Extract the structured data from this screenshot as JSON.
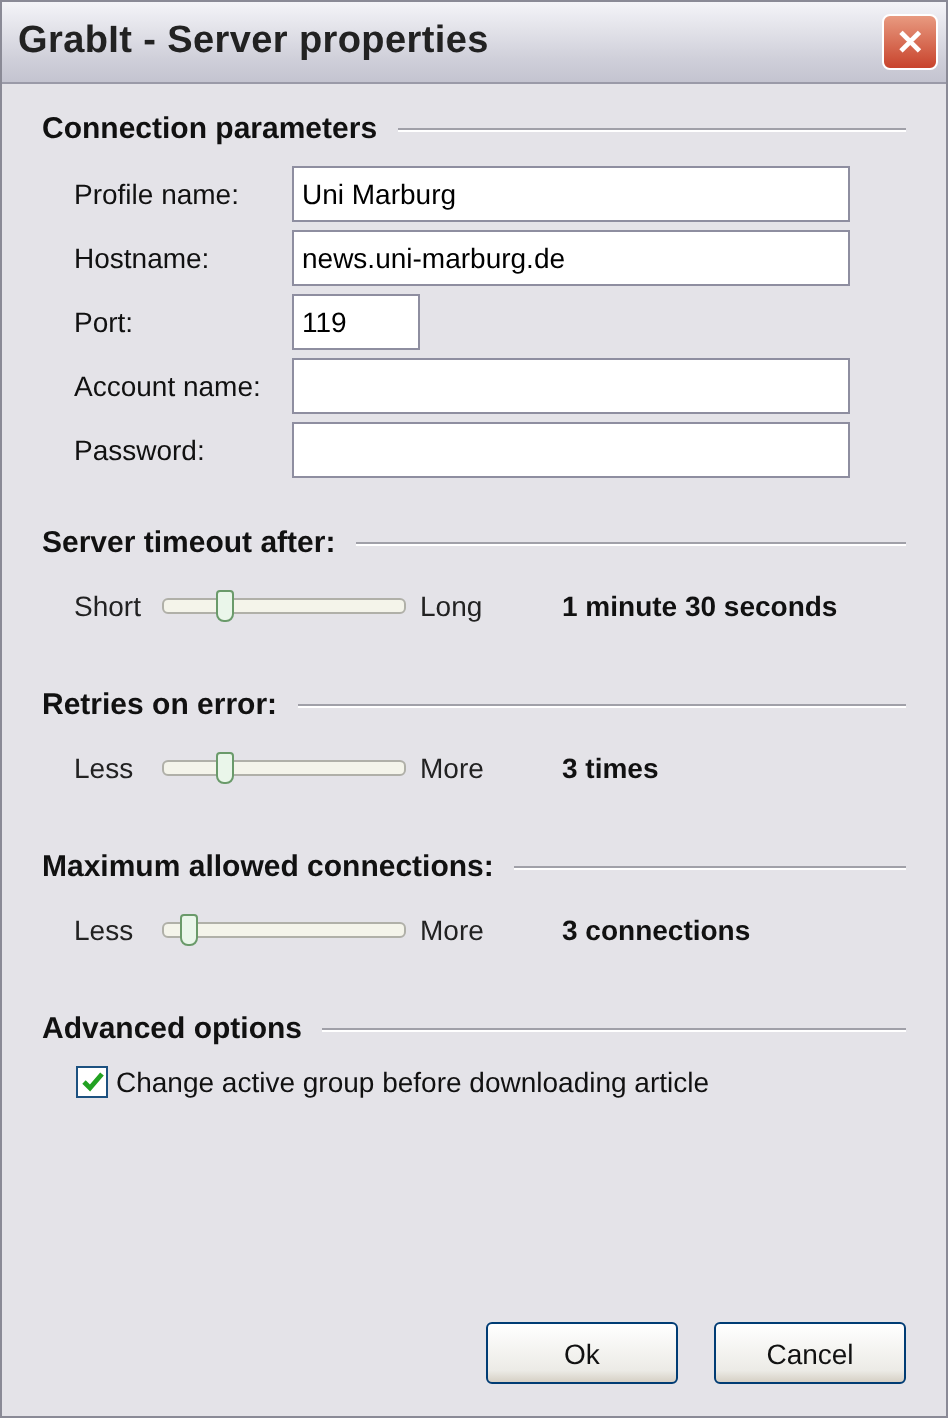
{
  "window": {
    "title": "GrabIt - Server properties",
    "close_label": "✕"
  },
  "sections": [
    {
      "kind": "fields",
      "title": "Connection parameters",
      "fields": [
        {
          "label": "Profile name:",
          "value": "Uni Marburg",
          "kind": "wide"
        },
        {
          "label": "Hostname:",
          "value": "news.uni-marburg.de",
          "kind": "wide"
        },
        {
          "label": "Port:",
          "value": "119",
          "kind": "narrow"
        },
        {
          "label": "Account name:",
          "kind": "wide"
        },
        {
          "label": "Password:",
          "kind": "wide"
        }
      ]
    },
    {
      "kind": "slider",
      "title": "Server timeout after:",
      "min_label": "Short",
      "max_label": "Long",
      "level": 0.25,
      "reading": "1 minute 30 seconds"
    },
    {
      "kind": "slider",
      "title": "Retries on error:",
      "min_label": "Less",
      "max_label": "More",
      "level": 0.25,
      "reading": "3 times"
    },
    {
      "kind": "slider",
      "title": "Maximum allowed connections:",
      "min_label": "Less",
      "max_label": "More",
      "level": 0.1,
      "reading": "3 connections"
    },
    {
      "kind": "checks",
      "title": "Advanced options",
      "options": [
        {
          "label": "Change active group before downloading article",
          "checked": true
        }
      ]
    }
  ],
  "buttons": [
    "Ok",
    "Cancel"
  ]
}
